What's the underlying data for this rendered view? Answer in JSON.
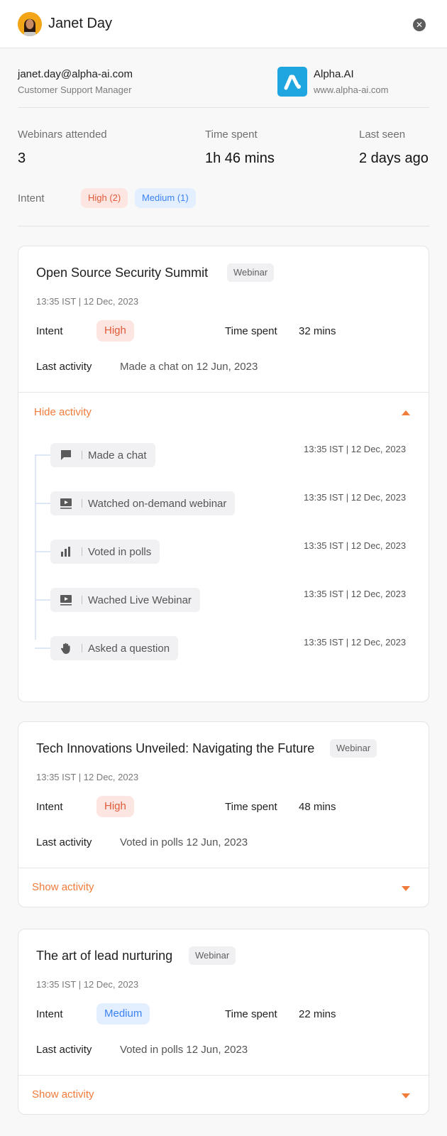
{
  "header": {
    "name": "Janet Day"
  },
  "profile": {
    "email": "janet.day@alpha-ai.com",
    "role": "Customer Support Manager",
    "company_name": "Alpha.AI",
    "company_url": "www.alpha-ai.com"
  },
  "stats": [
    {
      "label": "Webinars attended",
      "value": "3"
    },
    {
      "label": "Time spent",
      "value": "1h 46 mins"
    },
    {
      "label": "Last seen",
      "value": "2 days ago"
    }
  ],
  "intent_summary": {
    "label": "Intent",
    "high": "High (2)",
    "medium": "Medium (1)"
  },
  "labels": {
    "intent": "Intent",
    "time_spent": "Time spent",
    "last_activity": "Last activity"
  },
  "webinars": [
    {
      "title": "Open Source Security Summit",
      "tag": "Webinar",
      "time": "13:35 IST |  12 Dec, 2023",
      "intent": "High",
      "time_spent": "32 mins",
      "last_activity": "Made a chat on 12 Jun, 2023",
      "toggle": "Hide activity",
      "activities": [
        {
          "icon": "chat-icon",
          "label": "Made a chat",
          "time": "13:35 IST |  12 Dec, 2023"
        },
        {
          "icon": "video-play-icon",
          "label": "Watched on-demand webinar",
          "time": "13:35 IST |  12 Dec, 2023"
        },
        {
          "icon": "bar-chart-icon",
          "label": "Voted in polls",
          "time": "13:35 IST |  12 Dec, 2023"
        },
        {
          "icon": "video-play-icon",
          "label": "Wached Live Webinar",
          "time": "13:35 IST |  12 Dec, 2023"
        },
        {
          "icon": "raised-hand-icon",
          "label": "Asked a question",
          "time": "13:35 IST |  12 Dec, 2023"
        }
      ]
    },
    {
      "title": "Tech Innovations Unveiled: Navigating the Future",
      "tag": "Webinar",
      "time": "13:35 IST |  12 Dec, 2023",
      "intent": "High",
      "time_spent": "48 mins",
      "last_activity": "Voted in polls 12 Jun, 2023",
      "toggle": "Show activity"
    },
    {
      "title": "The art of lead nurturing",
      "tag": "Webinar",
      "time": "13:35 IST |  12 Dec, 2023",
      "intent": "Medium",
      "time_spent": "22 mins",
      "last_activity": "Voted in polls 12 Jun, 2023",
      "toggle": "Show activity"
    }
  ],
  "colors": {
    "accent": "#f07b3a",
    "high_bg": "#fde6e1",
    "high_text": "#e05a3a",
    "medium_bg": "#e3efff",
    "medium_text": "#3b82f0",
    "logo_bg": "#1fa6e0",
    "avatar_bg": "#f2a516"
  }
}
